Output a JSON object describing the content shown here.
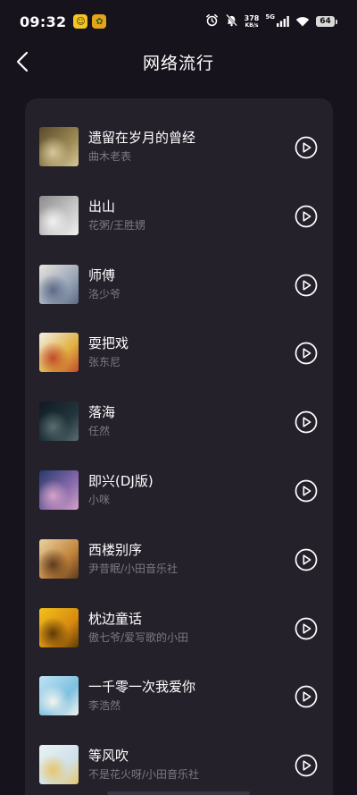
{
  "status_bar": {
    "time": "09:32",
    "net_speed_value": "378",
    "net_speed_unit": "KB/s",
    "network_type": "5G",
    "battery": "64"
  },
  "header": {
    "title": "网络流行"
  },
  "songs": [
    {
      "title": "遗留在岁月的曾经",
      "artist": "曲木老表",
      "colors": [
        "#5a4a2a",
        "#9c8a56",
        "#d8c79a"
      ]
    },
    {
      "title": "出山",
      "artist": "花粥/王胜娚",
      "colors": [
        "#8c8c8c",
        "#c9c9c9",
        "#f1f1f1"
      ]
    },
    {
      "title": "师傅",
      "artist": "洛少爷",
      "colors": [
        "#e8e4de",
        "#9aa6b8",
        "#5c6a86"
      ]
    },
    {
      "title": "耍把戏",
      "artist": "张东尼",
      "colors": [
        "#f4efe6",
        "#e0b040",
        "#c24a2a"
      ]
    },
    {
      "title": "落海",
      "artist": "任然",
      "colors": [
        "#0f1a20",
        "#22343c",
        "#5a6e70"
      ]
    },
    {
      "title": "即兴(DJ版)",
      "artist": "小咪",
      "colors": [
        "#263a6a",
        "#8a6cae",
        "#d5a2c6"
      ]
    },
    {
      "title": "西楼别序",
      "artist": "尹昔眠/小田音乐社",
      "colors": [
        "#e8d2a0",
        "#c2833c",
        "#5e3a1c"
      ]
    },
    {
      "title": "枕边童话",
      "artist": "傲七爷/爱写歌的小田",
      "colors": [
        "#f2c21a",
        "#d88a10",
        "#5e3a08"
      ]
    },
    {
      "title": "一千零一次我爱你",
      "artist": "李浩然",
      "colors": [
        "#bfe3f2",
        "#7ec0e0",
        "#f4f4ee"
      ]
    },
    {
      "title": "等风吹",
      "artist": "不是花火呀/小田音乐社",
      "colors": [
        "#eaf2f4",
        "#cfe2ea",
        "#e7c66a"
      ]
    }
  ]
}
